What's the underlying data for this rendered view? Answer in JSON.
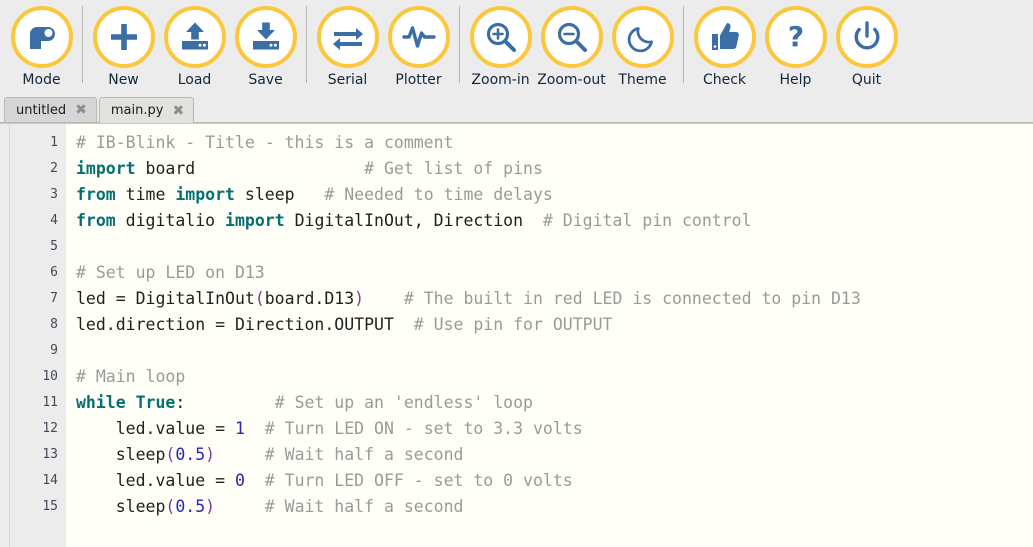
{
  "window": {
    "app": "Mu Editor",
    "toolbar_bg": "#ececec",
    "accent": "#fbc83c",
    "icon_color": "#3a6ea5",
    "editor_bg": "#fffff8"
  },
  "toolbar": {
    "items": [
      {
        "label": "Mode",
        "icon": "mode-icon"
      },
      {
        "label": "New",
        "icon": "plus-icon"
      },
      {
        "label": "Load",
        "icon": "upload-icon"
      },
      {
        "label": "Save",
        "icon": "download-icon"
      },
      {
        "label": "Serial",
        "icon": "serial-arrows-icon"
      },
      {
        "label": "Plotter",
        "icon": "plotter-wave-icon"
      },
      {
        "label": "Zoom-in",
        "icon": "zoom-in-icon"
      },
      {
        "label": "Zoom-out",
        "icon": "zoom-out-icon"
      },
      {
        "label": "Theme",
        "icon": "moon-icon"
      },
      {
        "label": "Check",
        "icon": "thumbs-up-icon"
      },
      {
        "label": "Help",
        "icon": "question-mark-icon"
      },
      {
        "label": "Quit",
        "icon": "power-icon"
      }
    ],
    "separators_after": [
      0,
      3,
      5,
      8
    ]
  },
  "tabs": [
    {
      "label": "untitled",
      "active": false,
      "close": "✖"
    },
    {
      "label": "main.py",
      "active": true,
      "close": "✖"
    }
  ],
  "editor": {
    "line_numbers": [
      "1",
      "2",
      "3",
      "4",
      "5",
      "6",
      "7",
      "8",
      "9",
      "10",
      "11",
      "12",
      "13",
      "14",
      "15"
    ],
    "lines": [
      [
        {
          "t": "# IB-Blink - Title - this is a comment",
          "c": "cmt"
        }
      ],
      [
        {
          "t": "import",
          "c": "kw"
        },
        {
          "t": " board                 ",
          "c": "pln"
        },
        {
          "t": "# Get list of pins",
          "c": "cmt"
        }
      ],
      [
        {
          "t": "from",
          "c": "kw"
        },
        {
          "t": " time ",
          "c": "pln"
        },
        {
          "t": "import",
          "c": "kw"
        },
        {
          "t": " sleep   ",
          "c": "pln"
        },
        {
          "t": "# Needed to time delays",
          "c": "cmt"
        }
      ],
      [
        {
          "t": "from",
          "c": "kw"
        },
        {
          "t": " digitalio ",
          "c": "pln"
        },
        {
          "t": "import",
          "c": "kw"
        },
        {
          "t": " DigitalInOut, Direction  ",
          "c": "pln"
        },
        {
          "t": "# Digital pin control",
          "c": "cmt"
        }
      ],
      [
        {
          "t": "",
          "c": "pln"
        }
      ],
      [
        {
          "t": "# Set up LED on D13",
          "c": "cmt"
        }
      ],
      [
        {
          "t": "led = DigitalInOut",
          "c": "pln"
        },
        {
          "t": "(",
          "c": "par"
        },
        {
          "t": "board.D13",
          "c": "pln"
        },
        {
          "t": ")",
          "c": "par"
        },
        {
          "t": "    ",
          "c": "pln"
        },
        {
          "t": "# The built in red LED is connected to pin D13",
          "c": "cmt"
        }
      ],
      [
        {
          "t": "led.direction = Direction.OUTPUT  ",
          "c": "pln"
        },
        {
          "t": "# Use pin for OUTPUT",
          "c": "cmt"
        }
      ],
      [
        {
          "t": "",
          "c": "pln"
        }
      ],
      [
        {
          "t": "# Main loop",
          "c": "cmt"
        }
      ],
      [
        {
          "t": "while",
          "c": "kw"
        },
        {
          "t": " ",
          "c": "pln"
        },
        {
          "t": "True",
          "c": "kw"
        },
        {
          "t": ":",
          "c": "pln"
        },
        {
          "t": "         ",
          "c": "pln"
        },
        {
          "t": "# Set up an 'endless' loop",
          "c": "cmt"
        }
      ],
      [
        {
          "t": "    led.value = ",
          "c": "pln"
        },
        {
          "t": "1",
          "c": "num"
        },
        {
          "t": "  ",
          "c": "pln"
        },
        {
          "t": "# Turn LED ON - set to 3.3 volts",
          "c": "cmt"
        }
      ],
      [
        {
          "t": "    sleep",
          "c": "pln"
        },
        {
          "t": "(",
          "c": "par"
        },
        {
          "t": "0.5",
          "c": "num"
        },
        {
          "t": ")",
          "c": "par"
        },
        {
          "t": "     ",
          "c": "pln"
        },
        {
          "t": "# Wait half a second",
          "c": "cmt"
        }
      ],
      [
        {
          "t": "    led.value = ",
          "c": "pln"
        },
        {
          "t": "0",
          "c": "num"
        },
        {
          "t": "  ",
          "c": "pln"
        },
        {
          "t": "# Turn LED OFF - set to 0 volts",
          "c": "cmt"
        }
      ],
      [
        {
          "t": "    sleep",
          "c": "pln"
        },
        {
          "t": "(",
          "c": "par"
        },
        {
          "t": "0.5",
          "c": "num"
        },
        {
          "t": ")",
          "c": "par"
        },
        {
          "t": "     ",
          "c": "pln"
        },
        {
          "t": "# Wait half a second",
          "c": "cmt"
        }
      ]
    ],
    "colors": {
      "keyword": "#057070",
      "comment": "#9a9a9a",
      "number": "#2727b0",
      "paren": "#7d3c98",
      "plain": "#1f1f1f",
      "gutter_bg": "#ececec",
      "gutter_text": "#3d4c5c"
    }
  }
}
